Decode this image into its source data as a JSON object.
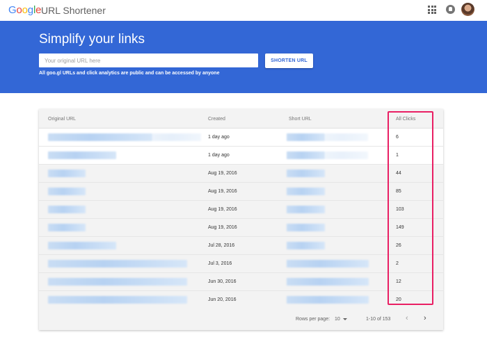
{
  "app": {
    "logo_letters": [
      "G",
      "o",
      "o",
      "g",
      "l",
      "e"
    ],
    "product_name": "URL Shortener"
  },
  "header": {
    "apps_icon": "apps-grid-icon",
    "notifications_icon": "notifications-icon",
    "avatar": "user-avatar"
  },
  "hero": {
    "title": "Simplify your links",
    "input_placeholder": "Your original URL here",
    "input_value": "",
    "shorten_label": "SHORTEN URL",
    "note": "All goo.gl URLs and click analytics are public and can be accessed by anyone"
  },
  "table": {
    "columns": [
      "Original URL",
      "Created",
      "Short URL",
      "All Clicks"
    ],
    "rows": [
      {
        "created": "1 day ago",
        "clicks": "6"
      },
      {
        "created": "1 day ago",
        "clicks": "1"
      },
      {
        "created": "Aug 19, 2016",
        "clicks": "44"
      },
      {
        "created": "Aug 19, 2016",
        "clicks": "85"
      },
      {
        "created": "Aug 19, 2016",
        "clicks": "103"
      },
      {
        "created": "Aug 19, 2016",
        "clicks": "149"
      },
      {
        "created": "Jul 28, 2016",
        "clicks": "26"
      },
      {
        "created": "Jul 3, 2016",
        "clicks": "2"
      },
      {
        "created": "Jun 30, 2016",
        "clicks": "12"
      },
      {
        "created": "Jun 20, 2016",
        "clicks": "20"
      }
    ]
  },
  "footer": {
    "rows_per_page_label": "Rows per page:",
    "rows_per_page_value": "10",
    "range": "1-10 of 153",
    "prev_icon": "chevron-left-icon",
    "next_icon": "chevron-right-icon"
  },
  "colors": {
    "hero_bg": "#3367d6",
    "highlight": "#e91e63"
  }
}
